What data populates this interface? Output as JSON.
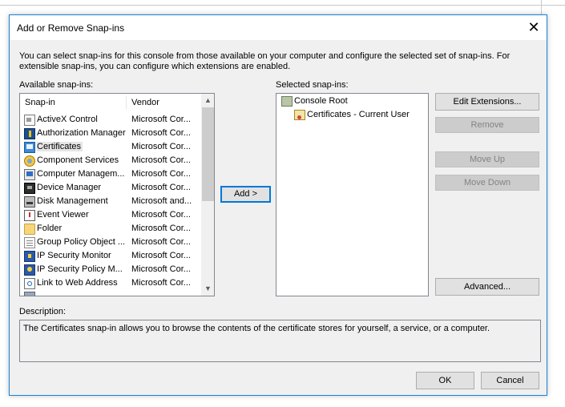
{
  "dialog": {
    "title": "Add or Remove Snap-ins",
    "intro": "You can select snap-ins for this console from those available on your computer and configure the selected set of snap-ins. For extensible snap-ins, you can configure which extensions are enabled."
  },
  "available": {
    "label": "Available snap-ins:",
    "columns": {
      "snapin": "Snap-in",
      "vendor": "Vendor"
    },
    "items": [
      {
        "name": "ActiveX Control",
        "vendor": "Microsoft Cor...",
        "icon": "activex-control-icon"
      },
      {
        "name": "Authorization Manager",
        "vendor": "Microsoft Cor...",
        "icon": "authorization-manager-icon"
      },
      {
        "name": "Certificates",
        "vendor": "Microsoft Cor...",
        "icon": "certificates-icon",
        "selected": true
      },
      {
        "name": "Component Services",
        "vendor": "Microsoft Cor...",
        "icon": "component-services-icon"
      },
      {
        "name": "Computer Managem...",
        "vendor": "Microsoft Cor...",
        "icon": "computer-management-icon"
      },
      {
        "name": "Device Manager",
        "vendor": "Microsoft Cor...",
        "icon": "device-manager-icon"
      },
      {
        "name": "Disk Management",
        "vendor": "Microsoft and...",
        "icon": "disk-management-icon"
      },
      {
        "name": "Event Viewer",
        "vendor": "Microsoft Cor...",
        "icon": "event-viewer-icon"
      },
      {
        "name": "Folder",
        "vendor": "Microsoft Cor...",
        "icon": "folder-icon"
      },
      {
        "name": "Group Policy Object ...",
        "vendor": "Microsoft Cor...",
        "icon": "group-policy-object-icon"
      },
      {
        "name": "IP Security Monitor",
        "vendor": "Microsoft Cor...",
        "icon": "ip-security-monitor-icon"
      },
      {
        "name": "IP Security Policy M...",
        "vendor": "Microsoft Cor...",
        "icon": "ip-security-policy-icon"
      },
      {
        "name": "Link to Web Address",
        "vendor": "Microsoft Cor...",
        "icon": "link-to-web-address-icon"
      }
    ]
  },
  "add_button": "Add >",
  "selected": {
    "label": "Selected snap-ins:",
    "root": "Console Root",
    "child": "Certificates - Current User"
  },
  "buttons": {
    "edit_extensions": "Edit Extensions...",
    "remove": "Remove",
    "move_up": "Move Up",
    "move_down": "Move Down",
    "advanced": "Advanced...",
    "ok": "OK",
    "cancel": "Cancel"
  },
  "description": {
    "label": "Description:",
    "text": "The Certificates snap-in allows you to browse the contents of the certificate stores for yourself, a service, or a computer."
  },
  "colors": {
    "dialog_border": "#1883d7",
    "default_button_border": "#0078d7",
    "selection_highlight": "#e5e5e5",
    "disabled_button": "#cccccc"
  }
}
